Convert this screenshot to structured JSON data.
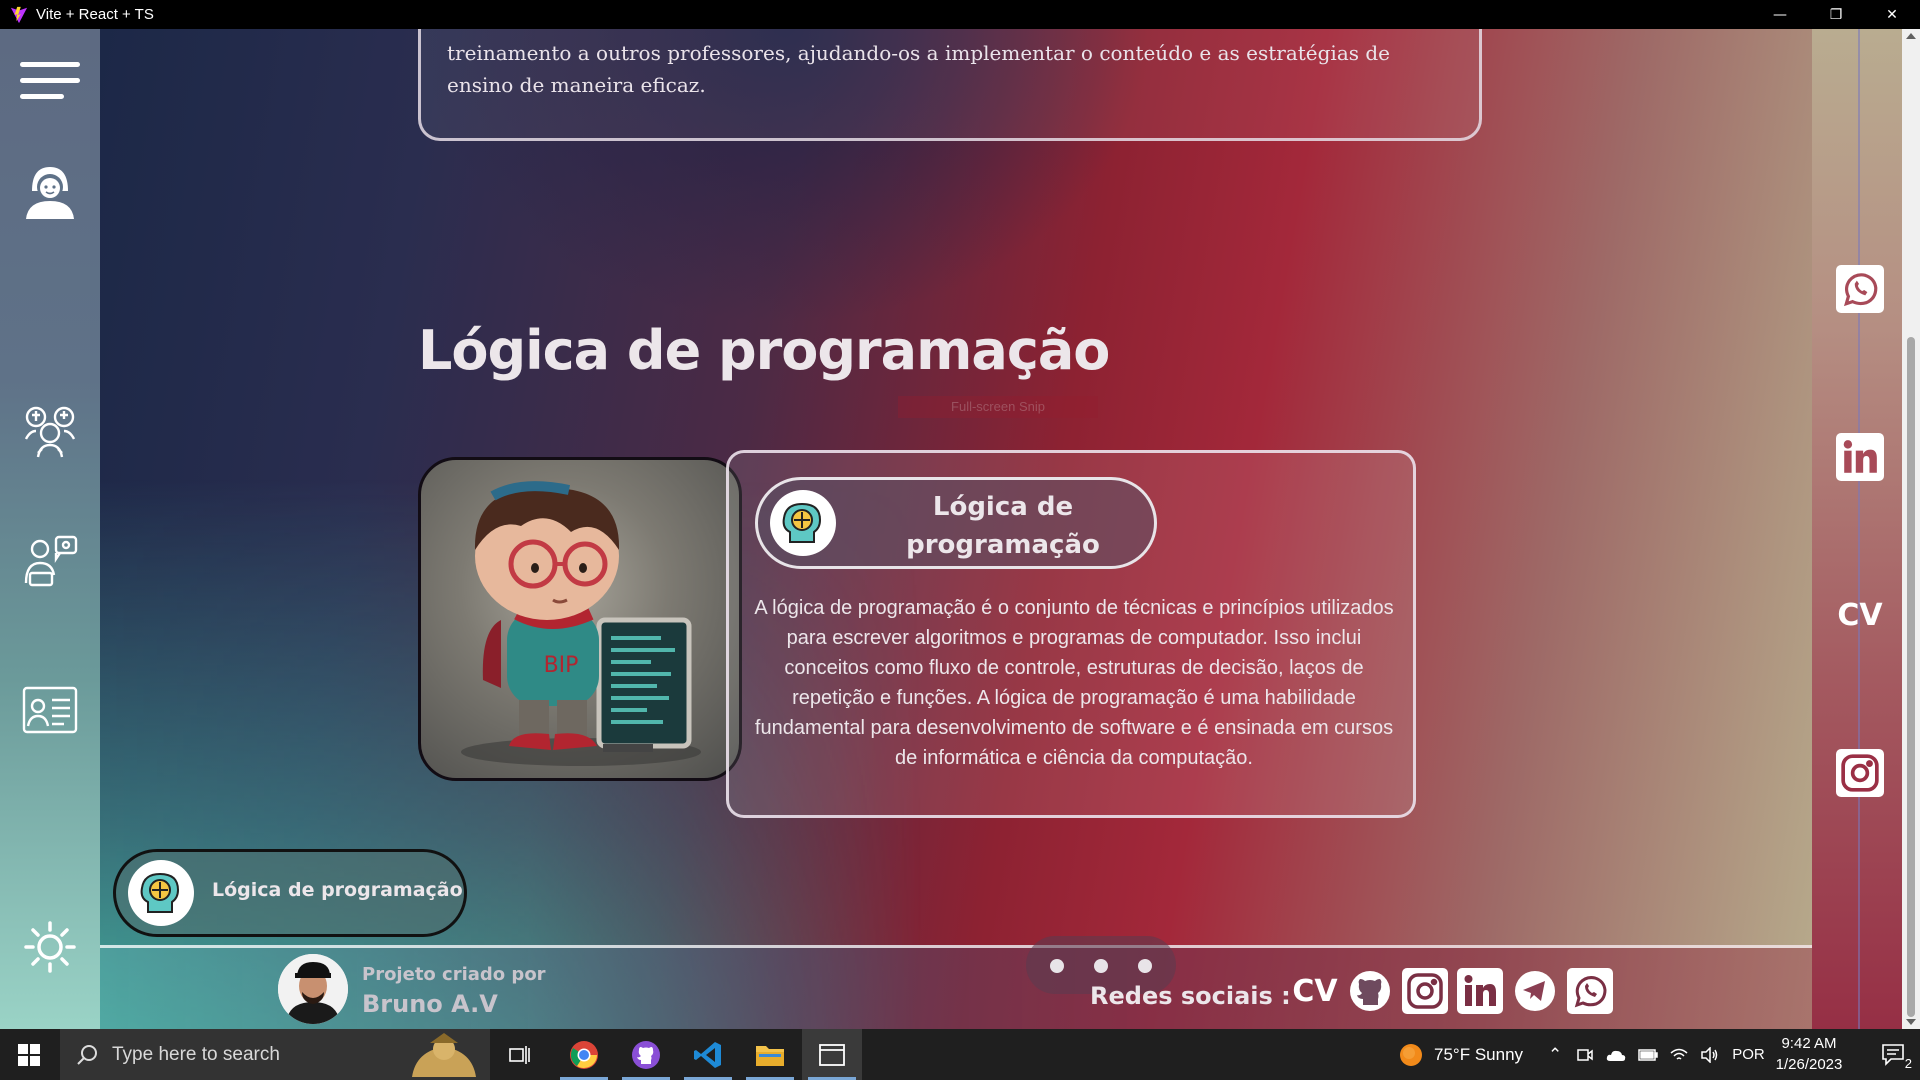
{
  "window": {
    "title": "Vite + React + TS",
    "controls": {
      "minimize": "—",
      "restore": "❐",
      "close": "✕"
    }
  },
  "colors": {
    "accent_left": "#4abea8",
    "accent_mid": "#8d2232",
    "accent_right": "#b7ab8c",
    "card_border": "#e8e4e8"
  },
  "left_sidebar": {
    "items": [
      {
        "name": "menu",
        "icon": "hamburger-menu-icon"
      },
      {
        "name": "profile",
        "icon": "person-icon"
      },
      {
        "name": "team",
        "icon": "team-icon"
      },
      {
        "name": "teacher",
        "icon": "teacher-icon"
      },
      {
        "name": "projects",
        "icon": "document-person-icon"
      },
      {
        "name": "theme",
        "icon": "sun-icon"
      }
    ]
  },
  "previous_card": {
    "text": "treinamento a outros professores, ajudando-os a implementar o conteúdo e as estratégias de ensino de maneira eficaz."
  },
  "section": {
    "title": "Lógica de programação",
    "snip_label": "Full-screen Snip"
  },
  "detail_card": {
    "pill_title": "Lógica de programação",
    "pill_icon": "brain-logic-icon",
    "description": "A lógica de programação é o conjunto de técnicas e princípios utilizados para escrever algoritmos e programas de computador. Isso inclui conceitos como fluxo de controle, estruturas de decisão, laços de repetição e funções. A lógica de programação é uma habilidade fundamental para desenvolvimento de software e é ensinada em cursos de informática e ciência da computação.",
    "image_badge": "BIP"
  },
  "floating_pill": {
    "label": "Lógica de programação",
    "icon": "brain-logic-icon"
  },
  "footer": {
    "credit_label": "Projeto criado por",
    "credit_name": "Bruno A.V",
    "social_label": "Redes sociais :",
    "cv": "CV",
    "social_icons": [
      "cv",
      "github-icon",
      "instagram-icon",
      "linkedin-icon",
      "telegram-icon",
      "whatsapp-icon"
    ],
    "carousel_dots": 3
  },
  "right_sidebar": {
    "cv": "CV",
    "icons": [
      "whatsapp-icon",
      "linkedin-icon",
      "cv",
      "instagram-icon"
    ]
  },
  "taskbar": {
    "search_placeholder": "Type here to search",
    "weather": "75°F  Sunny",
    "language": "POR",
    "time": "9:42 AM",
    "date": "1/26/2023",
    "notifications": "2"
  }
}
